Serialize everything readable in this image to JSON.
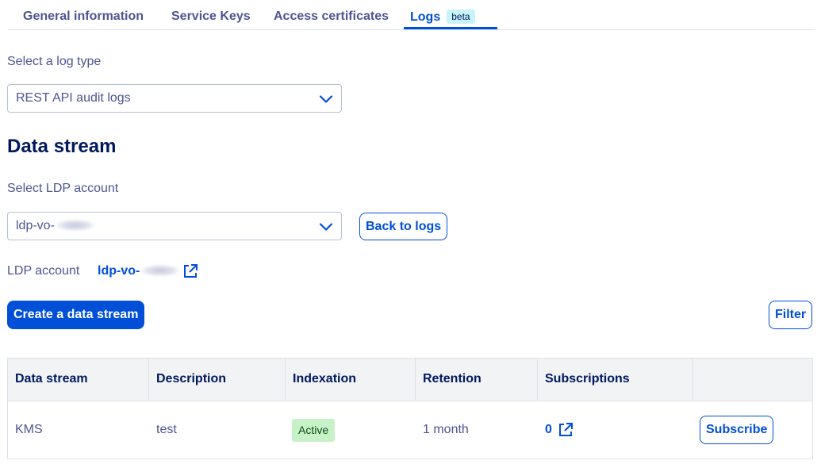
{
  "tabs": [
    {
      "label": "General information",
      "active": false
    },
    {
      "label": "Service Keys",
      "active": false
    },
    {
      "label": "Access certificates",
      "active": false
    },
    {
      "label": "Logs",
      "active": true,
      "badge": "beta"
    }
  ],
  "log_type": {
    "label": "Select a log type",
    "selected": "REST API audit logs"
  },
  "section_title": "Data stream",
  "ldp_select": {
    "label": "Select LDP account",
    "selected_prefix": "ldp-vo-"
  },
  "back_to_logs_label": "Back to logs",
  "ldp_account": {
    "label": "LDP account",
    "value_prefix": "ldp-vo-"
  },
  "create_stream_label": "Create a data stream",
  "filter_label": "Filter",
  "table": {
    "columns": [
      "Data stream",
      "Description",
      "Indexation",
      "Retention",
      "Subscriptions",
      ""
    ],
    "rows": [
      {
        "data_stream": "KMS",
        "description": "test",
        "indexation": "Active",
        "retention": "1 month",
        "subscriptions": "0",
        "action": "Subscribe"
      }
    ]
  },
  "colors": {
    "primary": "#0050d7",
    "heading": "#00185e",
    "text": "#4d5592",
    "active_badge_bg": "#c7f2c8",
    "beta_badge_bg": "#c9f3fb"
  },
  "icons": [
    "chevron-down-icon",
    "external-link-icon"
  ]
}
